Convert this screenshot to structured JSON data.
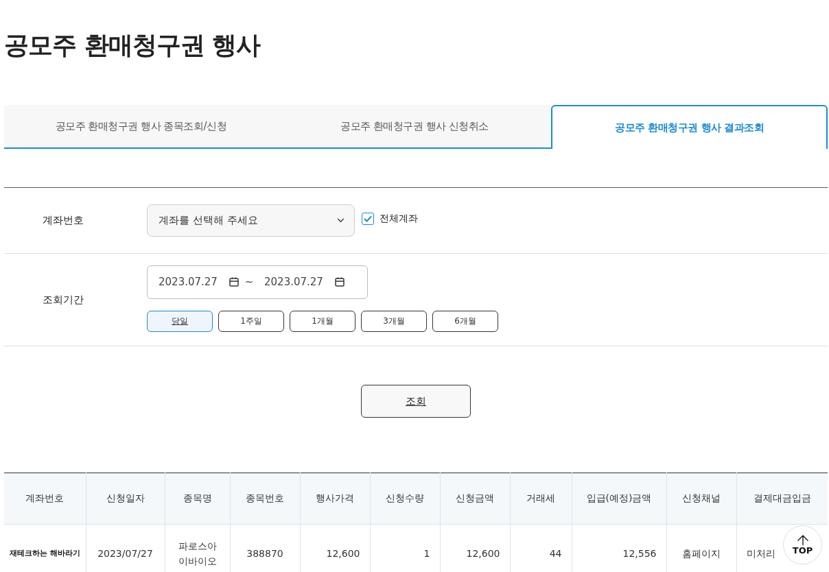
{
  "title": "공모주 환매청구권 행사",
  "tabs": [
    {
      "label": "공모주 환매청구권 행사 종목조회/신청",
      "selected": false
    },
    {
      "label": "공모주 환매청구권 행사 신청취소",
      "selected": false
    },
    {
      "label": "공모주 환매청구권 행사 결과조회",
      "selected": true
    }
  ],
  "form": {
    "account": {
      "label": "계좌번호",
      "placeholder": "계좌를 선택해 주세요",
      "all_accounts": {
        "label": "전체계좌",
        "checked": true
      }
    },
    "period": {
      "label": "조회기간",
      "start": "2023.07.27",
      "separator": "~",
      "end": "2023.07.27",
      "ranges": [
        {
          "label": "당일",
          "selected": true
        },
        {
          "label": "1주일",
          "selected": false
        },
        {
          "label": "1개월",
          "selected": false
        },
        {
          "label": "3개월",
          "selected": false
        },
        {
          "label": "6개월",
          "selected": false
        }
      ]
    }
  },
  "search_button": "조회",
  "table": {
    "columns": [
      {
        "label": "계좌번호",
        "kind": "name"
      },
      {
        "label": "신청일자",
        "kind": "text"
      },
      {
        "label": "종목명",
        "kind": "text"
      },
      {
        "label": "종목번호",
        "kind": "text"
      },
      {
        "label": "행사가격",
        "kind": "number"
      },
      {
        "label": "신청수량",
        "kind": "number"
      },
      {
        "label": "신청금액",
        "kind": "number"
      },
      {
        "label": "거래세",
        "kind": "number"
      },
      {
        "label": "입급(예정)금액",
        "kind": "number"
      },
      {
        "label": "신청채널",
        "kind": "text"
      },
      {
        "label": "결제대금입금",
        "kind": "text"
      }
    ],
    "rows": [
      [
        "재테크하는 해바라기",
        "2023/07/27",
        "파로스아이바이오",
        "388870",
        "12,600",
        "1",
        "12,600",
        "44",
        "12,556",
        "홈페이지",
        "미처리"
      ]
    ]
  },
  "top_button": "TOP"
}
